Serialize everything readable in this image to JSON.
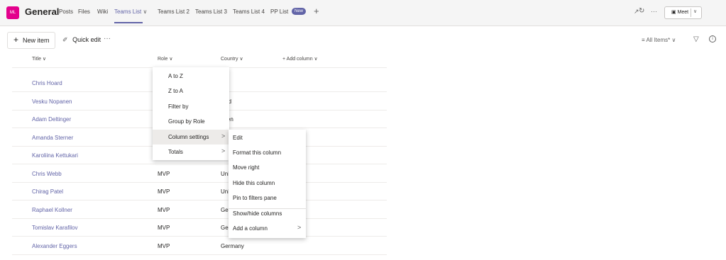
{
  "header": {
    "avatar_initials": "ML",
    "team_title": "General",
    "tabs": [
      {
        "label": "Posts"
      },
      {
        "label": "Files"
      },
      {
        "label": "Wiki"
      },
      {
        "label": "Teams List"
      },
      {
        "label": "Teams List 2"
      },
      {
        "label": "Teams List 3"
      },
      {
        "label": "Teams List 4"
      },
      {
        "label": "PP List"
      }
    ],
    "active_tab_chevron": "∨",
    "new_badge": "New",
    "add_tab": "+",
    "expand_icon": "↗",
    "refresh_icon": "↻",
    "more_icon": "···",
    "meet_label": "▣ Meet",
    "meet_chevron": "∨",
    "accent": "#6264a7",
    "avatar_color": "#e3008c"
  },
  "commandbar": {
    "new_item_icon": "+",
    "new_item": "New item",
    "quick_edit_icon": "✐",
    "quick_edit": "Quick edit",
    "more": "···",
    "view": "≡ All Items*  ∨",
    "filter_icon": "▽",
    "info_icon": "i"
  },
  "list": {
    "columns": [
      "Title ∨",
      "Role ∨",
      "Country ∨",
      "+  Add column ∨"
    ],
    "rows": [
      {
        "title": "Chris Hoard",
        "role": "",
        "country": ""
      },
      {
        "title": "Vesku Nopanen",
        "role": "",
        "country": "land"
      },
      {
        "title": "Adam Deltinger",
        "role": "",
        "country": "eden"
      },
      {
        "title": "Amanda Sterner",
        "role": "",
        "country": ""
      },
      {
        "title": "Karoliina Kettukari",
        "role": "",
        "country": ""
      },
      {
        "title": "Chris Webb",
        "role": "MVP",
        "country": "Uni"
      },
      {
        "title": "Chirag Patel",
        "role": "MVP",
        "country": "Uni"
      },
      {
        "title": "Raphael Kollner",
        "role": "MVP",
        "country": "Ger"
      },
      {
        "title": "Tomislav Karafilov",
        "role": "MVP",
        "country": "Ger"
      },
      {
        "title": "Alexander Eggers",
        "role": "MVP",
        "country": "Germany"
      }
    ]
  },
  "column_menu": {
    "items": [
      "A to Z",
      "Z to A",
      "Filter by",
      "Group by Role",
      "Column settings",
      "Totals"
    ],
    "submenu_arrow": ">"
  },
  "settings_submenu": {
    "items": [
      "Edit",
      "Format this column",
      "Move right",
      "Hide this column",
      "Pin to filters pane",
      "Show/hide columns",
      "Add a column"
    ],
    "submenu_arrow": ">"
  }
}
